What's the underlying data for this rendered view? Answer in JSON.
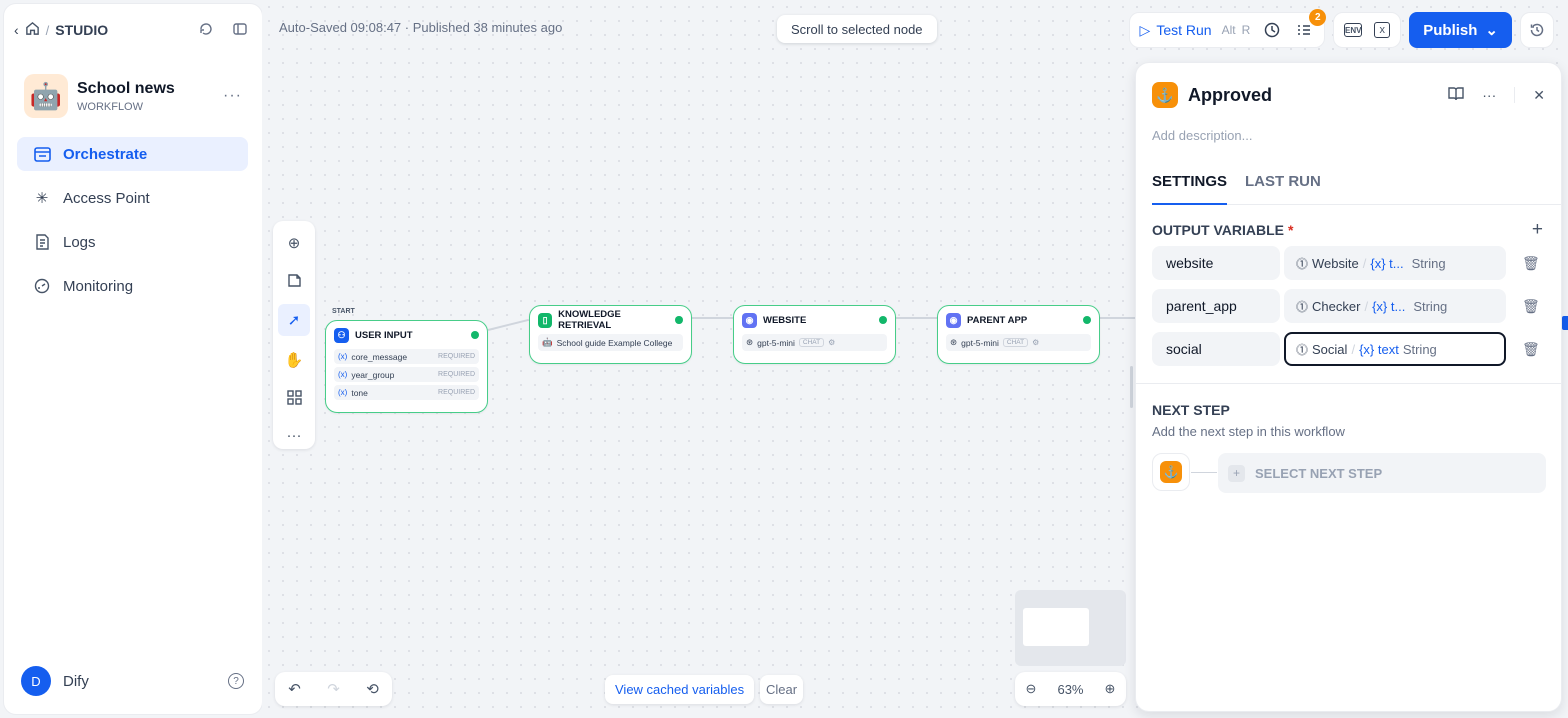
{
  "breadcrumb": {
    "section": "STUDIO"
  },
  "app": {
    "name": "School news",
    "type": "WORKFLOW",
    "icon": "🤖"
  },
  "nav": {
    "items": [
      {
        "label": "Orchestrate",
        "icon": "orchestrate-icon"
      },
      {
        "label": "Access Point",
        "icon": "access-point-icon"
      },
      {
        "label": "Logs",
        "icon": "logs-icon"
      },
      {
        "label": "Monitoring",
        "icon": "monitoring-icon"
      }
    ]
  },
  "user": {
    "initial": "D",
    "name": "Dify",
    "help": "?"
  },
  "header": {
    "status": "Auto-Saved 09:08:47 · Published 38 minutes ago",
    "scroll_button": "Scroll to selected node",
    "test_run": "Test Run",
    "shortcut": [
      "Alt",
      "R"
    ],
    "checklist_count": "2",
    "publish": "Publish"
  },
  "nodes": {
    "start_tag": "START",
    "user_input": {
      "title": "USER INPUT",
      "fields": [
        {
          "name": "core_message",
          "req": "REQUIRED"
        },
        {
          "name": "year_group",
          "req": "REQUIRED"
        },
        {
          "name": "tone",
          "req": "REQUIRED"
        }
      ]
    },
    "knowledge": {
      "title": "KNOWLEDGE RETRIEVAL",
      "dataset": "School guide Example College"
    },
    "website": {
      "title": "WEBSITE",
      "model": "gpt-5-mini",
      "mode": "CHAT"
    },
    "parent_app": {
      "title": "PARENT APP",
      "model": "gpt-5-mini",
      "mode": "CHAT"
    }
  },
  "bottom": {
    "view_cached": "View cached variables",
    "clear": "Clear",
    "zoom": "63%"
  },
  "panel": {
    "title": "Approved",
    "description_placeholder": "Add description...",
    "tabs": [
      "SETTINGS",
      "LAST RUN"
    ],
    "output_heading": "OUTPUT VARIABLE",
    "required_mark": "*",
    "variables": [
      {
        "name": "website",
        "node": "Website",
        "var": "{x} t...",
        "type": "String"
      },
      {
        "name": "parent_app",
        "node": "Checker",
        "var": "{x} t...",
        "type": "String"
      },
      {
        "name": "social",
        "node": "Social",
        "var": "{x} text",
        "type": "String"
      }
    ],
    "next_step_title": "NEXT STEP",
    "next_step_sub": "Add the next step in this workflow",
    "select_next": "SELECT NEXT STEP"
  },
  "colors": {
    "accent": "#155eef",
    "success": "#12b76a",
    "node_border": "#47cd89",
    "end_node": "#f79009"
  }
}
